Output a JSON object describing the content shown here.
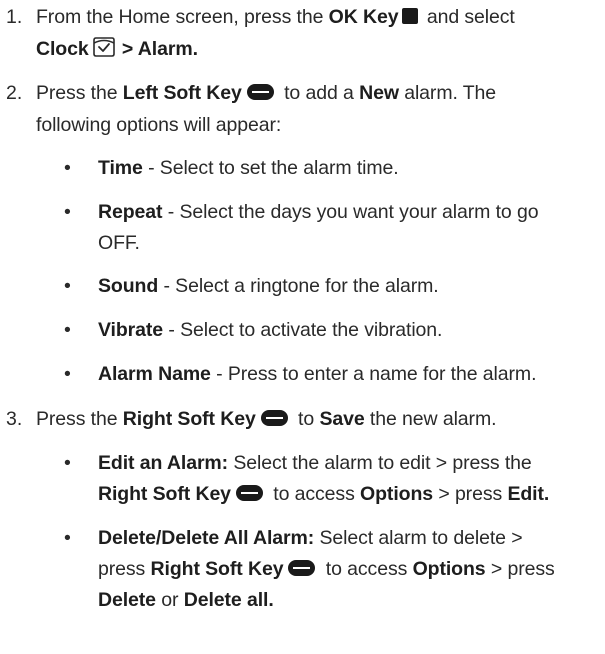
{
  "steps": [
    {
      "num": "1.",
      "t1": "From the Home screen, press the ",
      "b1": "OK Key",
      "t2": " and select",
      "b2": "Clock",
      "b3": " > Alarm."
    },
    {
      "num": "2.",
      "t1": "Press the ",
      "b1": "Left Soft Key",
      "t2": " to add a ",
      "b2": "New",
      "t3": " alarm. The",
      "t4": "following options will appear:",
      "options": [
        {
          "bullet": "•",
          "term": "Time",
          "desc": " - Select to set the alarm time."
        },
        {
          "bullet": "•",
          "term": "Repeat",
          "desc": " - Select the days you want your alarm to go",
          "desc2": "OFF."
        },
        {
          "bullet": "•",
          "term": "Sound",
          "desc": " - Select a ringtone for the alarm."
        },
        {
          "bullet": "•",
          "term": "Vibrate",
          "desc": " - Select to activate the vibration."
        },
        {
          "bullet": "•",
          "term": "Alarm Name",
          "desc": " - Press to enter a name for the alarm."
        }
      ]
    },
    {
      "num": "3.",
      "t1": "Press the ",
      "b1": "Right Soft Key",
      "t2": " to ",
      "b2": "Save",
      "t3": " the new alarm.",
      "subitems": [
        {
          "bullet": "•",
          "term": "Edit an Alarm:",
          "t1": " Select the alarm to edit > press the",
          "b1": "Right Soft Key",
          "t2": " to access ",
          "b2": "Options",
          "t3": " > press ",
          "b3": "Edit."
        },
        {
          "bullet": "•",
          "term": "Delete/Delete All Alarm:",
          "t1": " Select alarm to delete >",
          "t2": "press ",
          "b1": "Right Soft Key",
          "t3": " to access ",
          "b2": "Options",
          "t4": " > press",
          "b3": "Delete",
          "t5": " or ",
          "b4": "Delete all."
        }
      ]
    }
  ],
  "icons": {
    "ok_key": "ok-key-icon",
    "soft_key": "soft-key-icon",
    "clock": "clock-app-icon"
  }
}
